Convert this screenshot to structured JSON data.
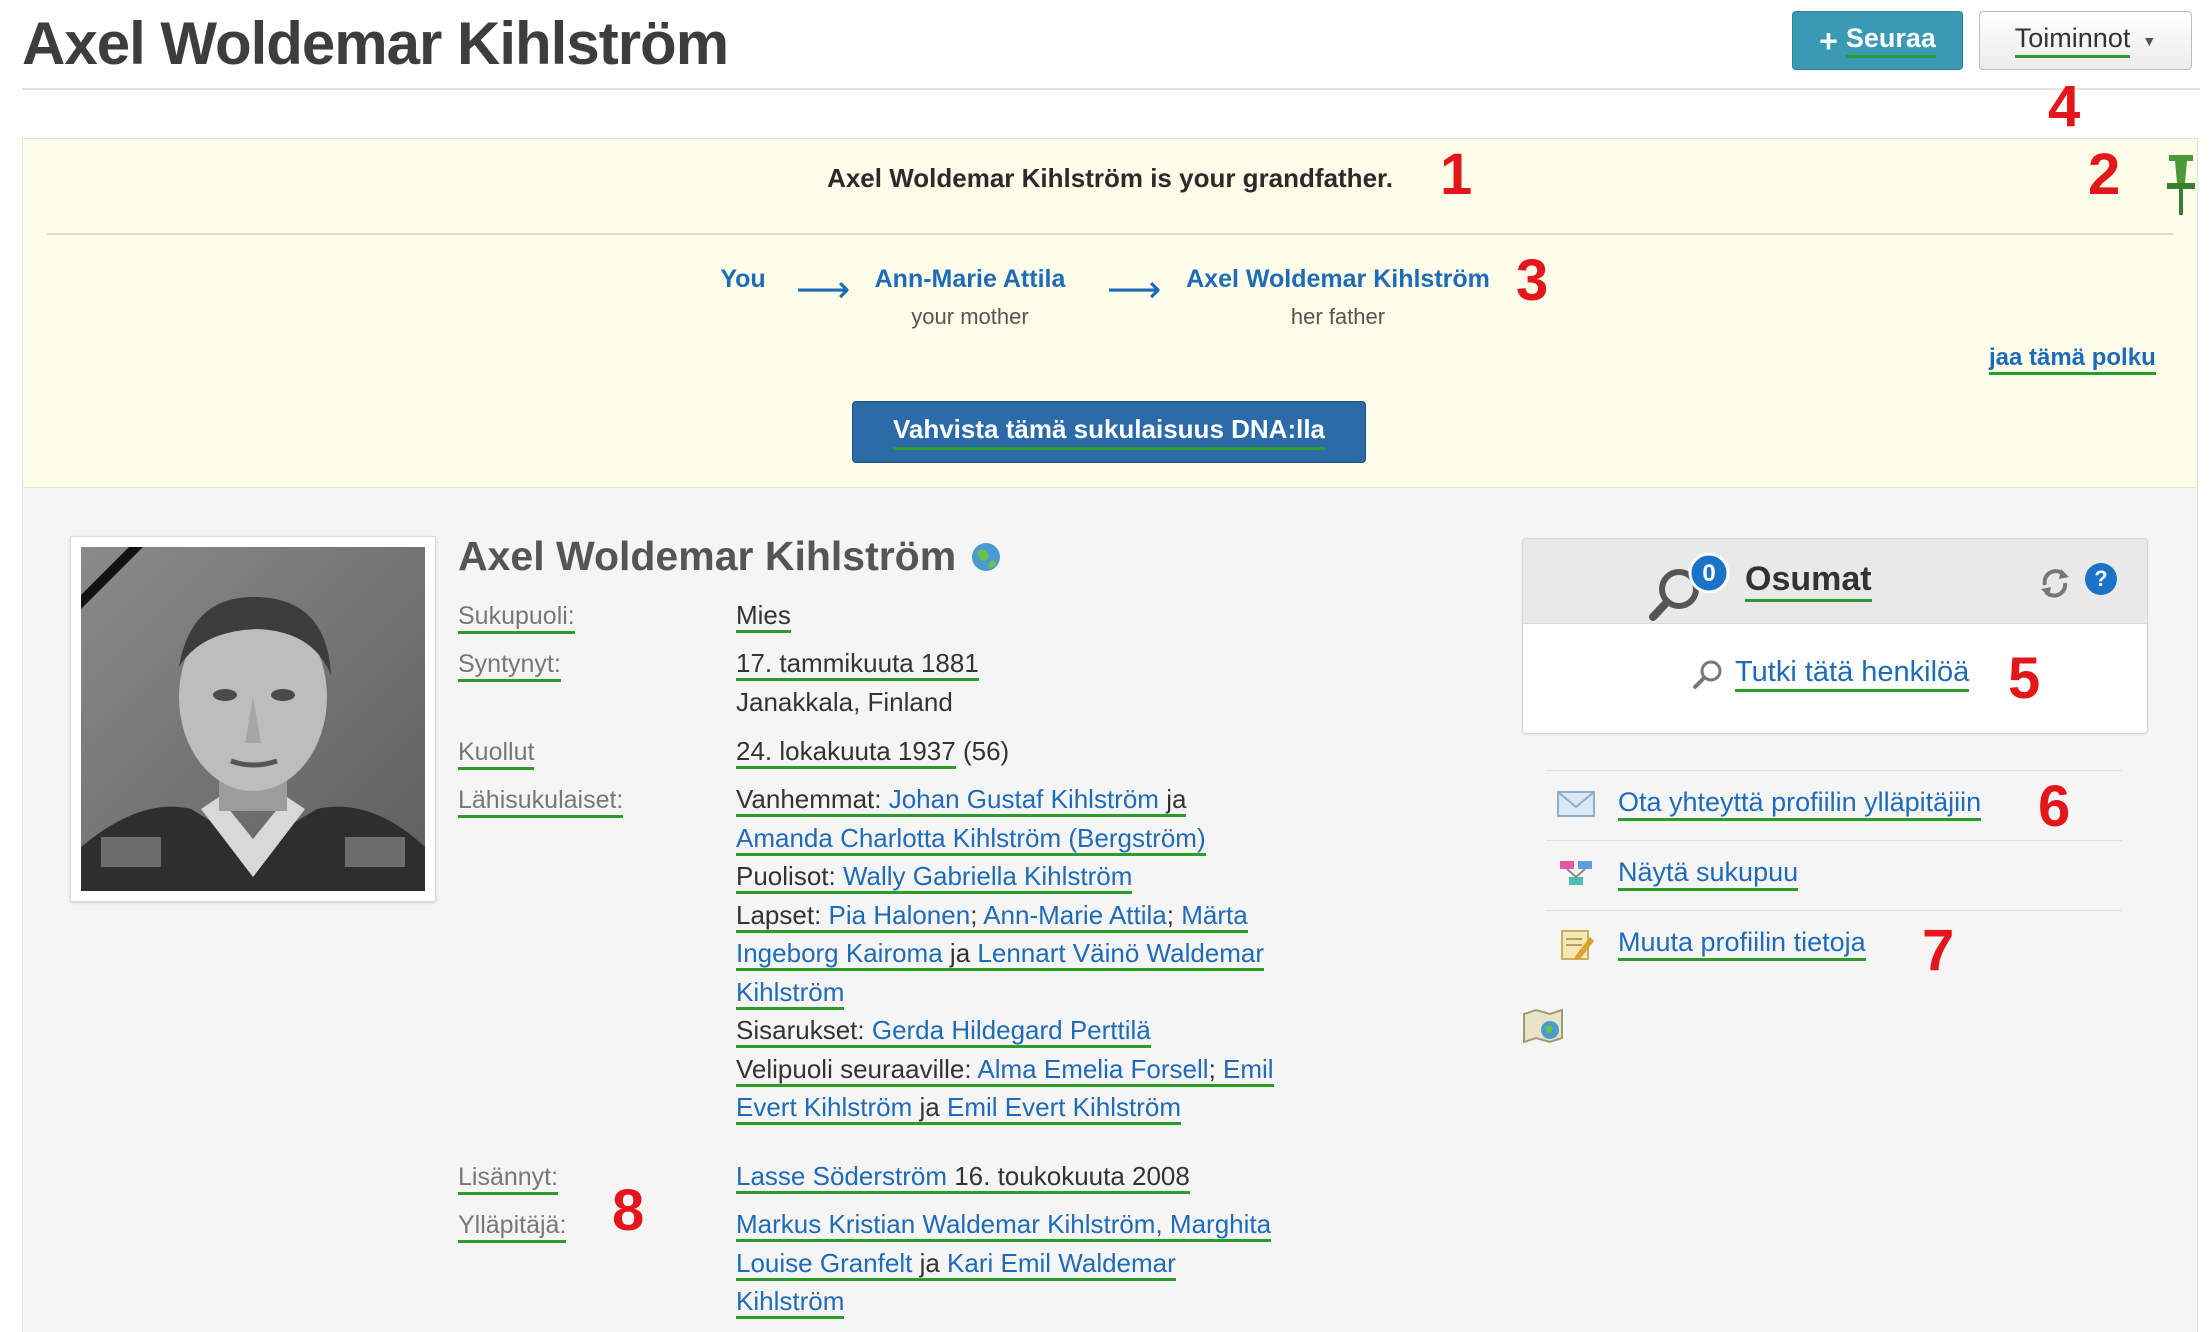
{
  "header": {
    "title": "Axel Woldemar Kihlström",
    "follow_plus": "+",
    "follow_label": "Seuraa",
    "actions_label": "Toiminnot",
    "actions_caret": "▼"
  },
  "relationship": {
    "statement": "Axel Woldemar Kihlström is your grandfather.",
    "path": [
      {
        "name": "You",
        "sub": ""
      },
      {
        "name": "Ann-Marie Attila",
        "sub": "your mother"
      },
      {
        "name": "Axel Woldemar Kihlström",
        "sub": "her father"
      }
    ],
    "arrow": "⟶",
    "share_label": "jaa tämä polku",
    "dna_button": "Vahvista tämä sukulaisuus DNA:lla"
  },
  "profile": {
    "name": "Axel Woldemar Kihlström",
    "labels": {
      "gender": "Sukupuoli:",
      "born": "Syntynyt:",
      "died": "Kuollut",
      "family": "Lähisukulaiset:",
      "added": "Lisännyt:",
      "managers": "Ylläpitäjä:"
    },
    "gender": "Mies",
    "birth_date": "17. tammikuuta 1881",
    "birth_place": "Janakkala, Finland",
    "death_date": "24. lokakuuta 1937",
    "death_age": "(56)",
    "family": {
      "parents_label": "Vanhemmat:",
      "parent1": "Johan Gustaf Kihlström",
      "and": "ja",
      "parent2": "Amanda Charlotta Kihlström (Bergström)",
      "spouses_label": "Puolisot:",
      "spouse1": "Wally Gabriella Kihlström",
      "children_label": "Lapset:",
      "child1": "Pia Halonen",
      "child2": "Ann-Marie Attila",
      "child3_a": "Märta",
      "child3_b": "Ingeborg Kairoma",
      "child4_a": "Lennart Väinö Waldemar",
      "child4_b": "Kihlström",
      "siblings_label": "Sisarukset:",
      "sibling1": "Gerda Hildegard Perttilä",
      "halfsib_label": "Velipuoli seuraaville:",
      "halfsib1": "Alma Emelia Forsell",
      "halfsib2_a": "Emil",
      "halfsib2_b": "Evert Kihlström",
      "halfsib3": "Emil Evert Kihlström",
      "sep": ";"
    },
    "added_by": "Lasse Söderström",
    "added_date": "16. toukokuuta 2008",
    "manager1_a": "Markus Kristian Waldemar Kihlström, Marghita",
    "manager1_b": "Louise Granfelt",
    "manager2_a": "Kari Emil Waldemar",
    "manager2_b": "Kihlström"
  },
  "matches": {
    "title": "Osumat",
    "count": "0",
    "help": "?",
    "research_label": "Tutki tätä henkilöä"
  },
  "side_links": {
    "contact": "Ota yhteyttä profiilin ylläpitäjiin",
    "tree": "Näytä sukupuu",
    "edit": "Muuta profiilin tietoja"
  },
  "markers": [
    "1",
    "2",
    "3",
    "4",
    "5",
    "6",
    "7",
    "8"
  ],
  "colors": {
    "link": "#1e6bb8",
    "follow_button": "#3a9ab5",
    "dna_button": "#2d6ba8",
    "banner_bg": "#fdfde9",
    "marker": "#e3171b",
    "underline": "#2a9d2a"
  }
}
